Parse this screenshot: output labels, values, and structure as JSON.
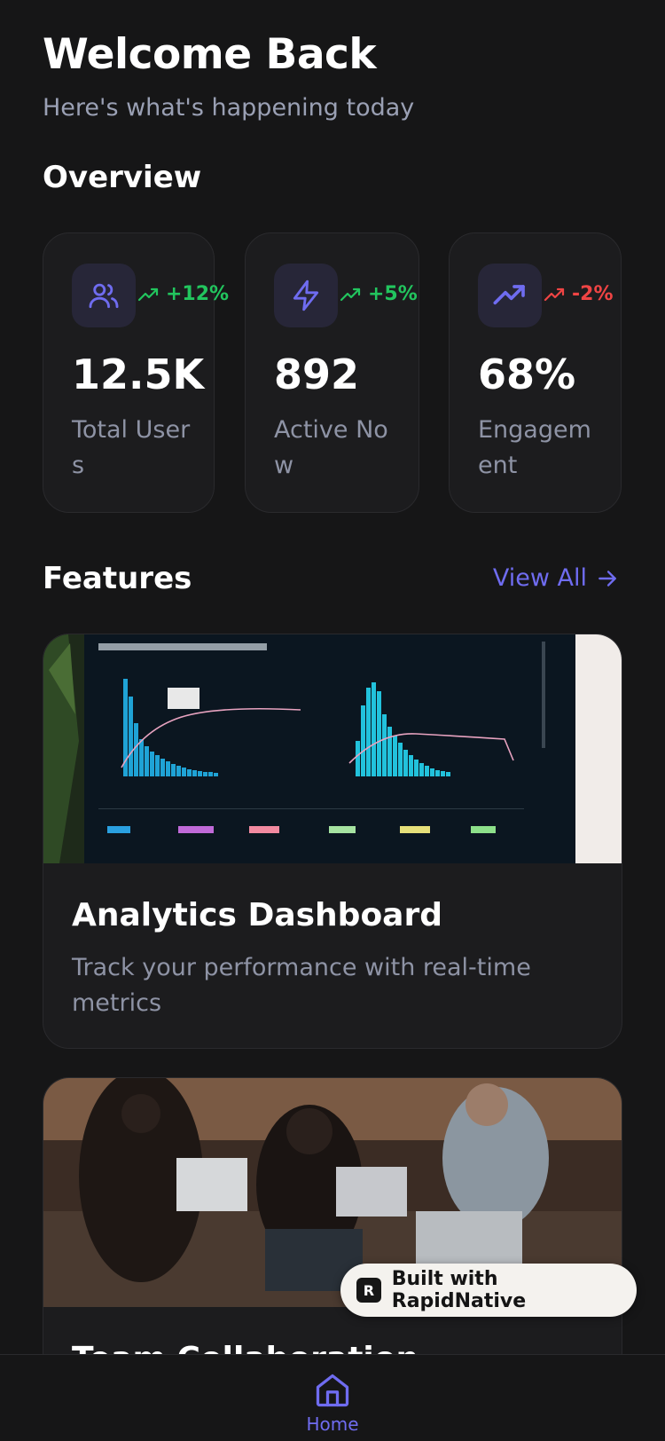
{
  "header": {
    "title": "Welcome Back",
    "subtitle": "Here's what's happening today"
  },
  "overview": {
    "title": "Overview",
    "stats": [
      {
        "icon": "users-icon",
        "trend": "+12%",
        "trend_direction": "up",
        "value": "12.5K",
        "label": "Total Users"
      },
      {
        "icon": "lightning-icon",
        "trend": "+5%",
        "trend_direction": "up",
        "value": "892",
        "label": "Active Now"
      },
      {
        "icon": "trending-up-icon",
        "trend": "-2%",
        "trend_direction": "down",
        "value": "68%",
        "label": "Engagement"
      }
    ]
  },
  "features": {
    "title": "Features",
    "view_all": "View All",
    "items": [
      {
        "title": "Analytics Dashboard",
        "description": "Track your performance with real-time metrics"
      },
      {
        "title": "Team Collaboration",
        "description": ""
      }
    ]
  },
  "badge": {
    "label": "Built with RapidNative"
  },
  "tabbar": {
    "home": "Home"
  },
  "colors": {
    "background": "#161617",
    "card": "#1c1c1e",
    "accent": "#6f6cf0",
    "positive": "#22c55e",
    "negative": "#ef4444"
  }
}
